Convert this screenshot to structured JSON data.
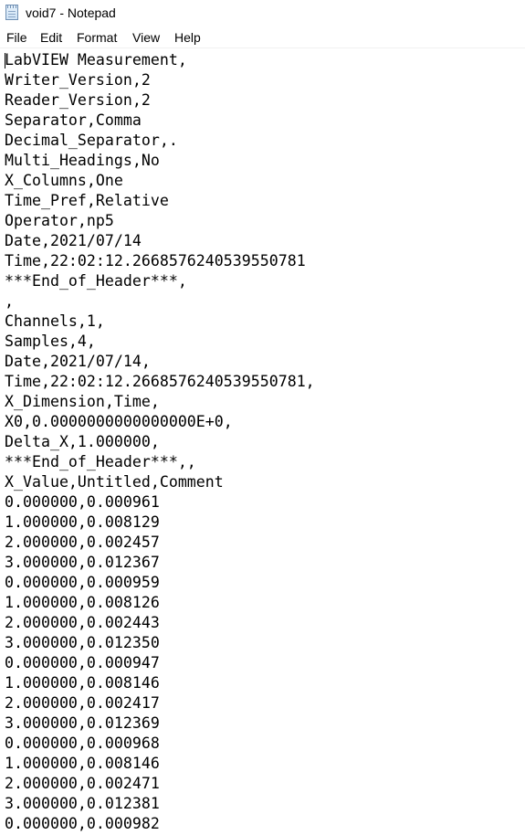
{
  "window": {
    "title": "void7 - Notepad",
    "app_icon": "notepad-icon"
  },
  "menu": {
    "items": [
      {
        "label": "File"
      },
      {
        "label": "Edit"
      },
      {
        "label": "Format"
      },
      {
        "label": "View"
      },
      {
        "label": "Help"
      }
    ]
  },
  "editor": {
    "lines": [
      "LabVIEW Measurement,",
      "Writer_Version,2",
      "Reader_Version,2",
      "Separator,Comma",
      "Decimal_Separator,.",
      "Multi_Headings,No",
      "X_Columns,One",
      "Time_Pref,Relative",
      "Operator,np5",
      "Date,2021/07/14",
      "Time,22:02:12.2668576240539550781",
      "***End_of_Header***,",
      ",",
      "Channels,1,",
      "Samples,4,",
      "Date,2021/07/14,",
      "Time,22:02:12.2668576240539550781,",
      "X_Dimension,Time,",
      "X0,0.0000000000000000E+0,",
      "Delta_X,1.000000,",
      "***End_of_Header***,,",
      "X_Value,Untitled,Comment",
      "0.000000,0.000961",
      "1.000000,0.008129",
      "2.000000,0.002457",
      "3.000000,0.012367",
      "0.000000,0.000959",
      "1.000000,0.008126",
      "2.000000,0.002443",
      "3.000000,0.012350",
      "0.000000,0.000947",
      "1.000000,0.008146",
      "2.000000,0.002417",
      "3.000000,0.012369",
      "0.000000,0.000968",
      "1.000000,0.008146",
      "2.000000,0.002471",
      "3.000000,0.012381",
      "0.000000,0.000982"
    ]
  }
}
